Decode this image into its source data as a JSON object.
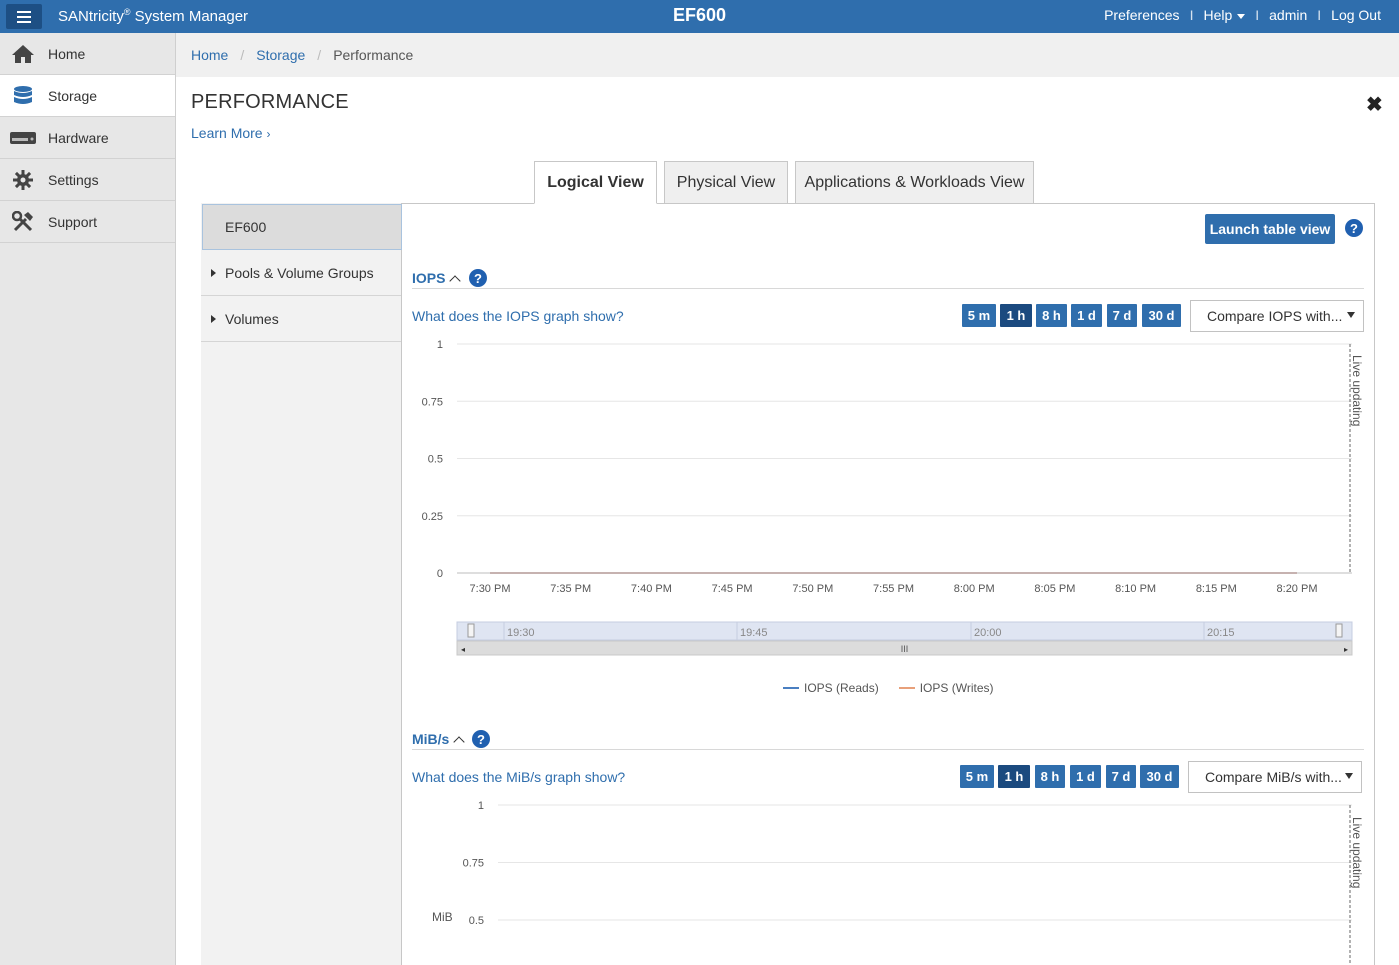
{
  "app": {
    "brand_name": "SANtricity",
    "brand_mark": "®",
    "brand_suffix": " System Manager",
    "system_name": "EF600"
  },
  "topnav": {
    "preferences": "Preferences",
    "help": "Help",
    "user": "admin",
    "logout": "Log Out",
    "separator": "I"
  },
  "sidebar": {
    "items": [
      {
        "label": "Home",
        "icon": "home-icon"
      },
      {
        "label": "Storage",
        "icon": "storage-icon"
      },
      {
        "label": "Hardware",
        "icon": "hardware-icon"
      },
      {
        "label": "Settings",
        "icon": "gear-icon"
      },
      {
        "label": "Support",
        "icon": "tools-icon"
      }
    ],
    "active": "Storage"
  },
  "breadcrumb": {
    "items": [
      "Home",
      "Storage",
      "Performance"
    ],
    "separator": "/"
  },
  "page": {
    "title": "PERFORMANCE",
    "learn_more": "Learn More",
    "close": "✖"
  },
  "tabs": [
    {
      "label": "Logical View",
      "active": true
    },
    {
      "label": "Physical View",
      "active": false
    },
    {
      "label": "Applications & Workloads View",
      "active": false
    }
  ],
  "tree": {
    "root": "EF600",
    "items": [
      "Pools & Volume Groups",
      "Volumes"
    ]
  },
  "toolbar": {
    "launch_table_view": "Launch table view",
    "help": "?"
  },
  "iops_section": {
    "title": "IOPS",
    "help": "?",
    "what_link": "What does the IOPS graph show?",
    "time_buttons": [
      "5 m",
      "1 h",
      "8 h",
      "1 d",
      "7 d",
      "30 d"
    ],
    "selected_time": "1 h",
    "compare": "Compare IOPS with...",
    "live_label": "Live updating"
  },
  "mibs_section": {
    "title": "MiB/s",
    "help": "?",
    "what_link": "What does the MiB/s graph show?",
    "time_buttons": [
      "5 m",
      "1 h",
      "8 h",
      "1 d",
      "7 d",
      "30 d"
    ],
    "selected_time": "1 h",
    "compare": "Compare MiB/s with...",
    "live_label": "Live updating",
    "ylabel": "MiB"
  },
  "legend": {
    "reads": "IOPS (Reads)",
    "writes": "IOPS (Writes)",
    "reads_color": "#4a7fc1",
    "writes_color": "#e8a07a"
  },
  "navigator": {
    "ticks": [
      "19:30",
      "19:45",
      "20:00",
      "20:15"
    ],
    "handle": "III"
  },
  "chart_data": [
    {
      "type": "line",
      "title": "IOPS",
      "x": [
        "7:30 PM",
        "7:35 PM",
        "7:40 PM",
        "7:45 PM",
        "7:50 PM",
        "7:55 PM",
        "8:00 PM",
        "8:05 PM",
        "8:10 PM",
        "8:15 PM",
        "8:20 PM"
      ],
      "yticks": [
        "0",
        "0.25",
        "0.5",
        "0.75",
        "1"
      ],
      "ylim": [
        0,
        1
      ],
      "series": [
        {
          "name": "IOPS (Reads)",
          "values": [
            0,
            0,
            0,
            0,
            0,
            0,
            0,
            0,
            0,
            0,
            0
          ]
        },
        {
          "name": "IOPS (Writes)",
          "values": [
            0,
            0,
            0,
            0,
            0,
            0,
            0,
            0,
            0,
            0,
            0
          ]
        }
      ],
      "grid": true
    },
    {
      "type": "line",
      "title": "MiB/s",
      "ylabel": "MiB",
      "yticks": [
        "0.5",
        "0.75",
        "1"
      ],
      "ylim": [
        0,
        1
      ],
      "grid": true
    }
  ]
}
